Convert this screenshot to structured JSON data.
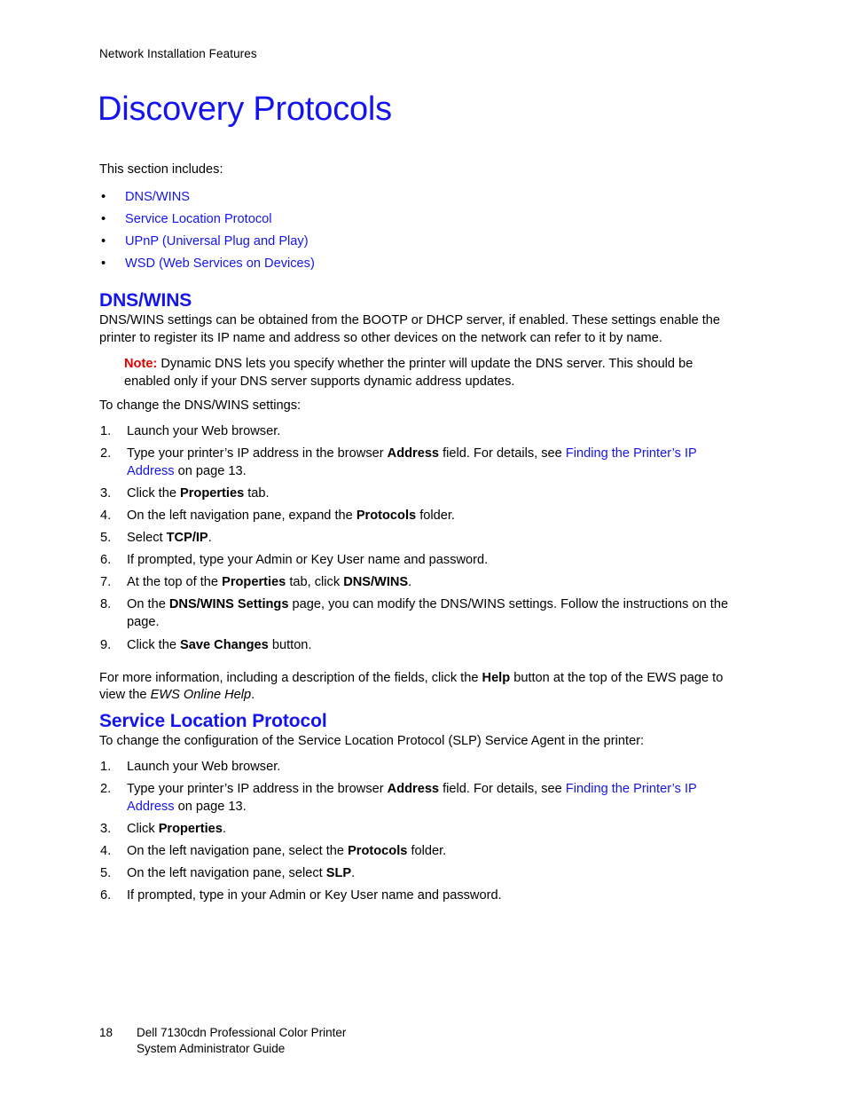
{
  "document": {
    "running_header": "Network Installation Features",
    "chapter_title": "Discovery Protocols",
    "colors": {
      "link_blue": "#1414F0",
      "heading_blue": "#1414F0",
      "note_red": "#E00000",
      "body_black": "#000000",
      "page_background": "#FFFFFF"
    }
  },
  "section_includes": {
    "intro": "This section includes:",
    "bullet_glyph": "•",
    "items": [
      {
        "label": "DNS/WINS"
      },
      {
        "label": "Service Location Protocol"
      },
      {
        "label": "UPnP (Universal Plug and Play)"
      },
      {
        "label": "WSD (Web Services on Devices)"
      }
    ]
  },
  "dnswins": {
    "heading": "DNS/WINS",
    "paragraph": "DNS/WINS settings can be obtained from the BOOTP or DHCP server, if enabled. These settings enable the printer to register its IP name and address so other devices on the network can refer to it by name.",
    "note": {
      "label": "Note:",
      "text": "Dynamic DNS lets you specify whether the printer will update the DNS server. This should be enabled only if your DNS server supports dynamic address updates."
    },
    "steps_intro": "To change the DNS/WINS settings:",
    "steps": [
      {
        "num": "1.",
        "parts": [
          {
            "t": "Launch your Web browser.",
            "s": "plain"
          }
        ]
      },
      {
        "num": "2.",
        "parts": [
          {
            "t": "Type your printer’s IP address in the browser ",
            "s": "plain"
          },
          {
            "t": "Address",
            "s": "bold"
          },
          {
            "t": " field. For details, see ",
            "s": "plain"
          },
          {
            "t": "Finding the Printer’s IP Address",
            "s": "link"
          },
          {
            "t": " on page 13.",
            "s": "plain"
          }
        ]
      },
      {
        "num": "3.",
        "parts": [
          {
            "t": "Click the ",
            "s": "plain"
          },
          {
            "t": "Properties",
            "s": "bold"
          },
          {
            "t": " tab.",
            "s": "plain"
          }
        ]
      },
      {
        "num": "4.",
        "parts": [
          {
            "t": "On the left navigation pane, expand the ",
            "s": "plain"
          },
          {
            "t": "Protocols",
            "s": "bold"
          },
          {
            "t": " folder.",
            "s": "plain"
          }
        ]
      },
      {
        "num": "5.",
        "parts": [
          {
            "t": "Select ",
            "s": "plain"
          },
          {
            "t": "TCP/IP",
            "s": "bold"
          },
          {
            "t": ".",
            "s": "plain"
          }
        ]
      },
      {
        "num": "6.",
        "parts": [
          {
            "t": "If prompted, type your Admin or Key User name and password.",
            "s": "plain"
          }
        ]
      },
      {
        "num": "7.",
        "parts": [
          {
            "t": "At the top of the ",
            "s": "plain"
          },
          {
            "t": "Properties",
            "s": "bold"
          },
          {
            "t": " tab, click ",
            "s": "plain"
          },
          {
            "t": "DNS/WINS",
            "s": "bold"
          },
          {
            "t": ".",
            "s": "plain"
          }
        ]
      },
      {
        "num": "8.",
        "parts": [
          {
            "t": "On the ",
            "s": "plain"
          },
          {
            "t": "DNS/WINS Settings",
            "s": "bold"
          },
          {
            "t": " page, you can modify the DNS/WINS settings. Follow the instructions on the page.",
            "s": "plain"
          }
        ]
      },
      {
        "num": "9.",
        "parts": [
          {
            "t": "Click the ",
            "s": "plain"
          },
          {
            "t": "Save Changes",
            "s": "bold"
          },
          {
            "t": " button.",
            "s": "plain"
          }
        ]
      }
    ],
    "closing_paragraph": [
      {
        "t": "For more information, including a description of the fields, click the ",
        "s": "plain"
      },
      {
        "t": "Help",
        "s": "bold"
      },
      {
        "t": " button at the top of the EWS page to view the ",
        "s": "plain"
      },
      {
        "t": "EWS Online Help",
        "s": "italic"
      },
      {
        "t": ".",
        "s": "plain"
      }
    ]
  },
  "slp": {
    "heading": "Service Location Protocol",
    "steps_intro": "To change the configuration of the Service Location Protocol (SLP) Service Agent in the printer:",
    "steps": [
      {
        "num": "1.",
        "parts": [
          {
            "t": "Launch your Web browser.",
            "s": "plain"
          }
        ]
      },
      {
        "num": "2.",
        "parts": [
          {
            "t": "Type your printer’s IP address in the browser ",
            "s": "plain"
          },
          {
            "t": "Address",
            "s": "bold"
          },
          {
            "t": " field. For details, see ",
            "s": "plain"
          },
          {
            "t": "Finding the Printer’s IP Address",
            "s": "link"
          },
          {
            "t": " on page 13.",
            "s": "plain"
          }
        ]
      },
      {
        "num": "3.",
        "parts": [
          {
            "t": "Click ",
            "s": "plain"
          },
          {
            "t": "Properties",
            "s": "bold"
          },
          {
            "t": ".",
            "s": "plain"
          }
        ]
      },
      {
        "num": "4.",
        "parts": [
          {
            "t": "On the left navigation pane, select the ",
            "s": "plain"
          },
          {
            "t": "Protocols",
            "s": "bold"
          },
          {
            "t": " folder.",
            "s": "plain"
          }
        ]
      },
      {
        "num": "5.",
        "parts": [
          {
            "t": "On the left navigation pane, select ",
            "s": "plain"
          },
          {
            "t": "SLP",
            "s": "bold"
          },
          {
            "t": ".",
            "s": "plain"
          }
        ]
      },
      {
        "num": "6.",
        "parts": [
          {
            "t": "If prompted, type in your Admin or Key User name and password.",
            "s": "plain"
          }
        ]
      }
    ]
  },
  "footer": {
    "page_number": "18",
    "line1": "Dell 7130cdn Professional Color Printer",
    "line2": "System Administrator Guide"
  }
}
